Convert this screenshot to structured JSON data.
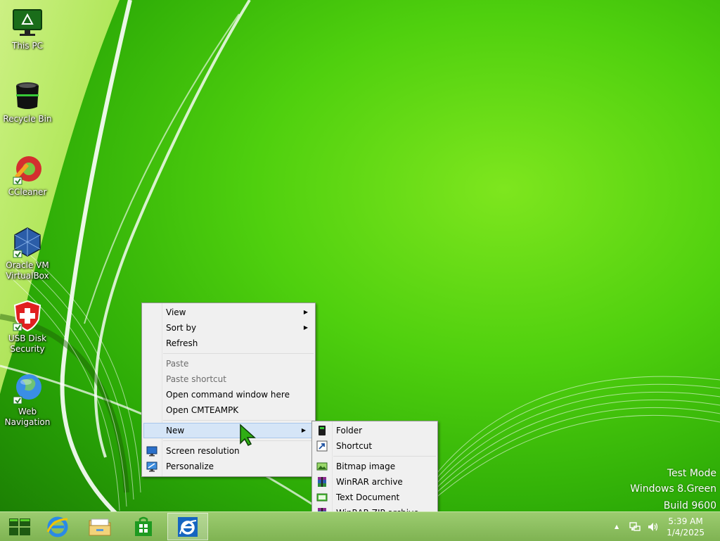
{
  "desktop": {
    "icons": [
      {
        "label": "This PC"
      },
      {
        "label": "Recycle Bin"
      },
      {
        "label": "CCleaner"
      },
      {
        "label": "Oracle VM VirtualBox"
      },
      {
        "label": "USB Disk Security"
      },
      {
        "label": "Web Navigation"
      }
    ]
  },
  "context_menu": {
    "items": [
      {
        "label": "View"
      },
      {
        "label": "Sort by"
      },
      {
        "label": "Refresh"
      },
      {
        "label": "Paste"
      },
      {
        "label": "Paste shortcut"
      },
      {
        "label": "Open command window here"
      },
      {
        "label": "Open CMTEAMPK"
      },
      {
        "label": "New"
      },
      {
        "label": "Screen resolution"
      },
      {
        "label": "Personalize"
      }
    ],
    "arrow": "▶"
  },
  "new_submenu": {
    "items": [
      {
        "label": "Folder"
      },
      {
        "label": "Shortcut"
      },
      {
        "label": "Bitmap image"
      },
      {
        "label": "WinRAR archive"
      },
      {
        "label": "Text Document"
      },
      {
        "label": "WinRAR ZIP archive"
      }
    ]
  },
  "watermark": {
    "line1": "Test Mode",
    "line2": "Windows 8.Green",
    "line3": "Build 9600"
  },
  "taskbar": {
    "tray_arrow": "▲",
    "time": "5:39 AM",
    "date": "1/4/2025"
  },
  "colors": {
    "accent_green": "#3fbf0a",
    "menu_highlight": "#d5e5f7"
  }
}
